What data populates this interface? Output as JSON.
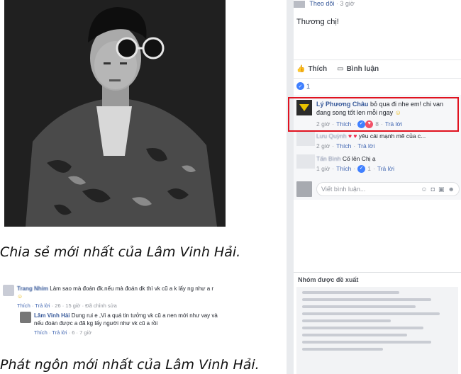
{
  "article": {
    "caption1": "Chia sẻ mới nhất của Lâm Vinh Hải.",
    "caption2": "Phát ngôn mới nhất của Lâm Vinh Hải."
  },
  "comment_shot": {
    "c1_name": "Trang Nhím",
    "c1_text": "Làm sao mà đoán đk.nếu mà đoán dk thì vk cũ a k lấy ng như a r",
    "c1_meta": {
      "like": "Thích",
      "dot": "·",
      "reply": "Trả lời",
      "count": "26",
      "time": "15 giờ",
      "edited": "Đã chỉnh sửa"
    },
    "c2_name": "Lâm Vinh Hải",
    "c2_text": "Dung rui e ,Vi a quá tin tưởng vk cũ a nen mới như vay và nếu đoán được a đã kg lấy người như vk cũ a rồi",
    "c2_meta": {
      "like": "Thích",
      "reply": "Trả lời",
      "count": "6",
      "time": "7 giờ"
    }
  },
  "fb": {
    "follow": "Theo dõi",
    "time_top": "3 giờ",
    "post_text": "Thương chị!",
    "like_btn": "Thích",
    "comment_btn": "Bình luận",
    "react_count": "1",
    "comments": [
      {
        "name": "Lý Phương Châu",
        "text": "bỏ qua đi nhe em! chi van đang song tốt len mỗi ngay",
        "time": "2 giờ",
        "like": "Thích",
        "count": "8",
        "reply": "Trả lời"
      },
      {
        "name": "Lưu Quỳnh",
        "text": "yêu cái mạnh mẽ của c...",
        "time": "2 giờ",
        "like": "Thích",
        "count": "",
        "reply": "Trả lời"
      },
      {
        "name": "Tấn Bình",
        "text": "Cố lên Chị ạ",
        "time": "1 giờ",
        "like": "Thích",
        "count": "1",
        "reply": "Trả lời"
      }
    ],
    "write_placeholder": "Viết bình luận...",
    "suggest_title": "Nhóm được đề xuất"
  },
  "colors": {
    "fb_blue": "#365899",
    "highlight": "#e0121f"
  }
}
